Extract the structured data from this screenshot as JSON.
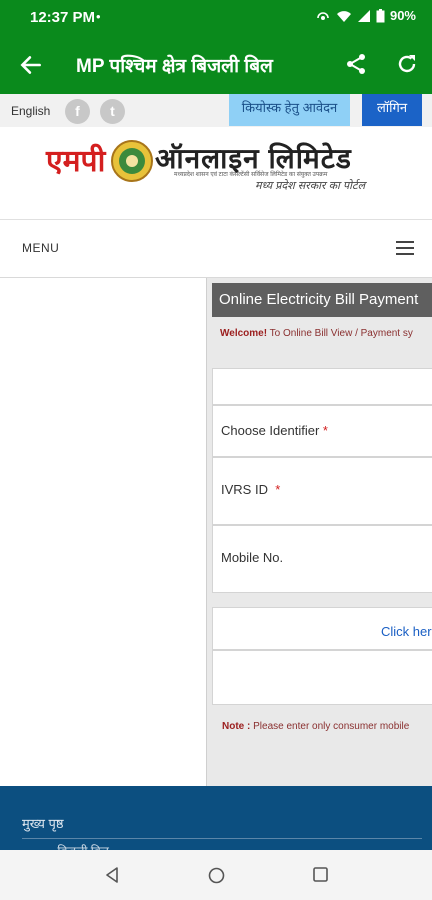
{
  "status": {
    "time": "12:37 PM",
    "dot": "•",
    "battery": "90%"
  },
  "appbar": {
    "title": "MP पश्चिम क्षेत्र बिजली बिल"
  },
  "topstrip": {
    "language": "English",
    "kiosk": "कियोस्क हेतु आवेदन",
    "login": "लॉगिन"
  },
  "logo": {
    "part1": "एमपी",
    "part2": "ऑनलाइन लिमिटेड",
    "fineprint": "मध्यप्रदेश शासन एवं टाटा कंसल्टेंसी सर्विसेज लिमिटेड का संयुक्त उपक्रम",
    "tagline": "मध्य प्रदेश सरकार का पोर्टल"
  },
  "menu": {
    "label": "MENU"
  },
  "panel": {
    "heading": "Online Electricity Bill Payment",
    "welcome_bold": "Welcome!",
    "welcome_text": " To Online Bill View / Payment sy",
    "fields": {
      "identifier": "Choose Identifier",
      "ivrs": "IVRS ID",
      "mobile": "Mobile No."
    },
    "required_mark": "*",
    "click_here": "Click her",
    "note_bold": "Note :",
    "note_text": " Please enter only consumer mobile"
  },
  "footer": {
    "home": "मुख्य पृष्ठ",
    "next": "— बिजली बिल"
  }
}
